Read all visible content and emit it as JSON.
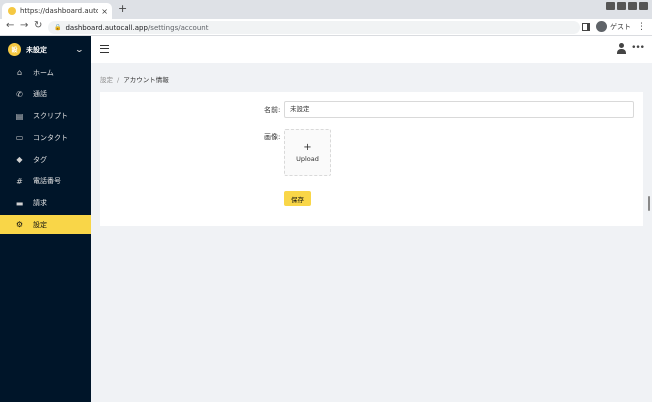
{
  "browser": {
    "tab_title": "https://dashboard.autocall.app/s",
    "tab_close": "×",
    "new_tab": "+",
    "url_host": "dashboard.autocall.app",
    "url_path": "/settings/account",
    "profile_label": "ゲスト",
    "back": "←",
    "forward": "→",
    "reload": "↻",
    "lock": "🔒",
    "menu": "⋮"
  },
  "sidebar": {
    "brand_logo_text": "設",
    "brand_name": "未設定",
    "items": [
      {
        "label": "ホーム",
        "icon": "home-icon",
        "glyph": "⌂"
      },
      {
        "label": "通話",
        "icon": "phone-icon",
        "glyph": "✆"
      },
      {
        "label": "スクリプト",
        "icon": "message-icon",
        "glyph": "▤"
      },
      {
        "label": "コンタクト",
        "icon": "contact-card-icon",
        "glyph": "▭"
      },
      {
        "label": "タグ",
        "icon": "tag-icon",
        "glyph": "◆"
      },
      {
        "label": "電話番号",
        "icon": "hash-icon",
        "glyph": "#"
      },
      {
        "label": "請求",
        "icon": "credit-card-icon",
        "glyph": "▬"
      },
      {
        "label": "設定",
        "icon": "gear-icon",
        "glyph": "⚙",
        "active": true
      }
    ]
  },
  "header": {
    "more": "•••"
  },
  "breadcrumb": {
    "parent": "設定",
    "separator": "/",
    "current": "アカウント情報"
  },
  "form": {
    "name_label": "名前:",
    "name_value": "未設定",
    "image_label": "画像:",
    "upload_plus": "+",
    "upload_label": "Upload",
    "save_label": "保存"
  },
  "colors": {
    "accent": "#f9d648",
    "sidebar_bg": "#001529",
    "page_bg": "#f0f2f5"
  }
}
